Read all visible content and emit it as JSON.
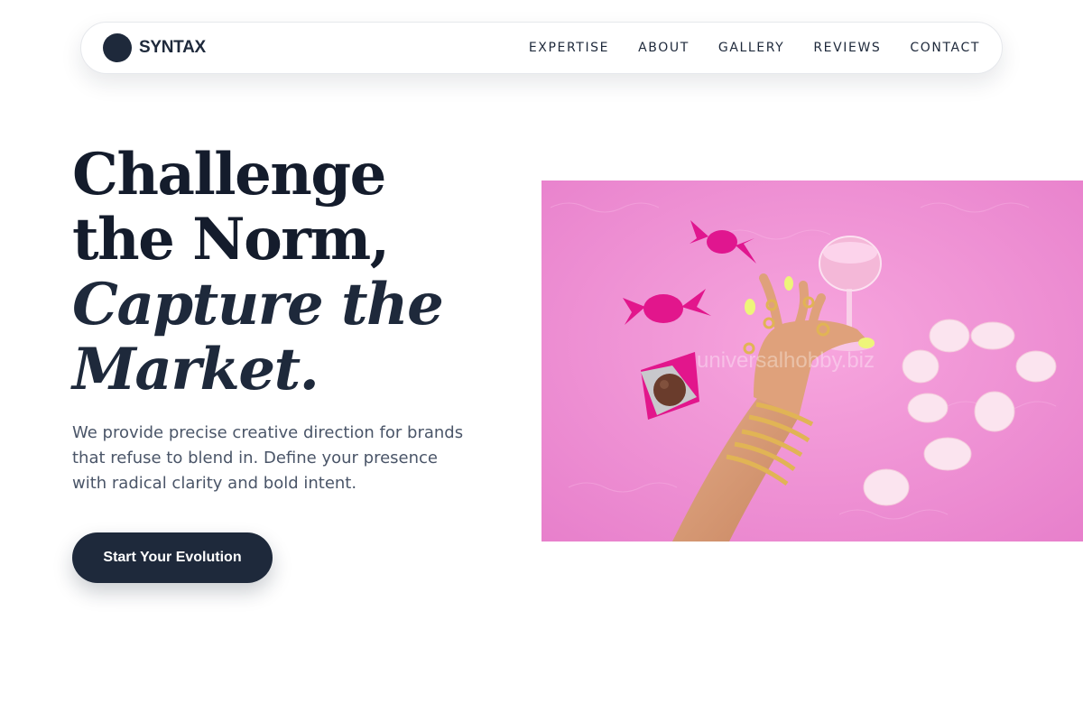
{
  "brand": {
    "name": "SYNTAX"
  },
  "nav": {
    "items": [
      {
        "label": "EXPERTISE"
      },
      {
        "label": "ABOUT"
      },
      {
        "label": "GALLERY"
      },
      {
        "label": "REVIEWS"
      },
      {
        "label": "CONTACT"
      }
    ]
  },
  "hero": {
    "title_line1": "Challenge",
    "title_line2": "the Norm,",
    "title_line3": "Capture the",
    "title_line4": "Market.",
    "description": "We provide precise creative direction for brands that refuse to blend in. Define your presence with radical clarity and bold intent.",
    "cta_label": "Start Your Evolution",
    "image_watermark": "universalhobby.biz"
  },
  "colors": {
    "brand": "#1e293b",
    "text_muted": "#4a5568",
    "image_background": "#f08fd4"
  }
}
